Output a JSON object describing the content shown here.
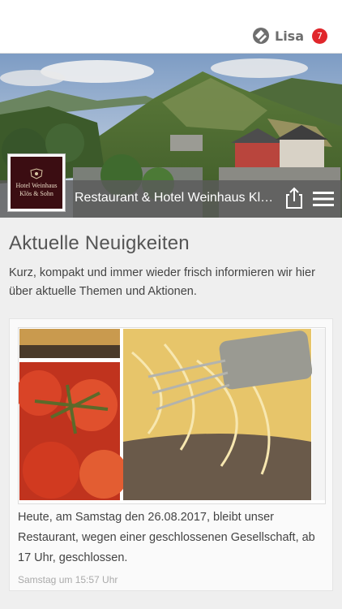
{
  "header": {
    "user_name": "Lisa",
    "notification_count": "7",
    "user_icon": "user-switch-icon"
  },
  "hero": {
    "title": "Restaurant & Hotel Weinhaus Klös & Sohn",
    "logo_line1": "Hotel Weinhaus",
    "logo_line2": "Klös & Sohn",
    "share_icon": "share-icon",
    "menu_icon": "hamburger-menu-icon"
  },
  "main": {
    "section_title": "Aktuelle Neuigkeiten",
    "intro": "Kurz, kompakt und immer wieder frisch informieren wir hier über aktuelle Themen und Aktionen."
  },
  "news": [
    {
      "text": "Heute, am Samstag den 26.08.2017, bleibt unser Restaurant, wegen einer geschlossenen Gesellschaft, ab 17 Uhr, geschlossen.",
      "timestamp": "Samstag um 15:57 Uhr"
    }
  ],
  "colors": {
    "badge": "#e0262b",
    "logo_background": "#3b0d12",
    "title_bar": "#5a5a5a"
  }
}
